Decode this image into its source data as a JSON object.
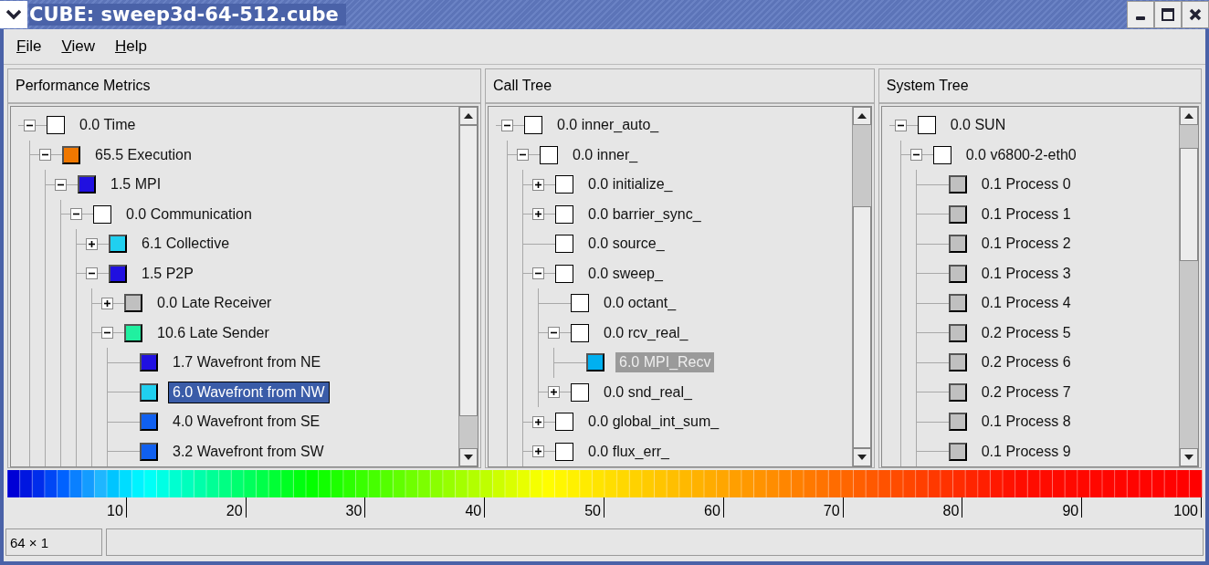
{
  "window": {
    "title": "CUBE: sweep3d-64-512.cube"
  },
  "menu": [
    "File",
    "View",
    "Help"
  ],
  "panels": [
    {
      "title": "Performance Metrics",
      "tree": [
        {
          "label": "0.0 Time",
          "color": "#ffffff",
          "expanded": true,
          "selected": false,
          "children": [
            {
              "label": "65.5 Execution",
              "color": "#f07800",
              "expanded": true,
              "selected": false,
              "children": [
                {
                  "label": "1.5 MPI",
                  "color": "#2010e0",
                  "expanded": true,
                  "selected": false,
                  "children": [
                    {
                      "label": "0.0 Communication",
                      "color": "#ffffff",
                      "expanded": true,
                      "selected": false,
                      "children": [
                        {
                          "label": "6.1 Collective",
                          "color": "#20d0f0",
                          "expanded": false,
                          "selected": false
                        },
                        {
                          "label": "1.5 P2P",
                          "color": "#2010e0",
                          "expanded": true,
                          "selected": false,
                          "children": [
                            {
                              "label": "0.0 Late Receiver",
                              "color": "#c0c0c0",
                              "expanded": false,
                              "selected": false
                            },
                            {
                              "label": "10.6 Late Sender",
                              "color": "#20f0a0",
                              "expanded": true,
                              "selected": false,
                              "children": [
                                {
                                  "label": "1.7 Wavefront from NE",
                                  "color": "#2010e0",
                                  "selected": false
                                },
                                {
                                  "label": "6.0 Wavefront from NW",
                                  "color": "#20d0f0",
                                  "selected": true,
                                  "focused": true
                                },
                                {
                                  "label": "4.0 Wavefront from SE",
                                  "color": "#1060f0",
                                  "selected": false
                                },
                                {
                                  "label": "3.2 Wavefront from SW",
                                  "color": "#1060f0",
                                  "selected": false
                                }
                              ]
                            }
                          ]
                        }
                      ]
                    }
                  ]
                }
              ]
            }
          ]
        }
      ]
    },
    {
      "title": "Call Tree",
      "tree": [
        {
          "label": "0.0 inner_auto_",
          "color": "#ffffff",
          "expanded": true,
          "selected": false,
          "children": [
            {
              "label": "0.0 inner_",
              "color": "#ffffff",
              "expanded": true,
              "selected": false,
              "children": [
                {
                  "label": "0.0 initialize_",
                  "color": "#ffffff",
                  "expanded": false,
                  "selected": false
                },
                {
                  "label": "0.0 barrier_sync_",
                  "color": "#ffffff",
                  "expanded": false,
                  "selected": false
                },
                {
                  "label": "0.0 source_",
                  "color": "#ffffff",
                  "selected": false
                },
                {
                  "label": "0.0 sweep_",
                  "color": "#ffffff",
                  "expanded": true,
                  "selected": false,
                  "children": [
                    {
                      "label": "0.0 octant_",
                      "color": "#ffffff",
                      "selected": false
                    },
                    {
                      "label": "0.0 rcv_real_",
                      "color": "#ffffff",
                      "expanded": true,
                      "selected": false,
                      "children": [
                        {
                          "label": "6.0 MPI_Recv",
                          "color": "#00b0f0",
                          "selected": true,
                          "focused": false
                        }
                      ]
                    },
                    {
                      "label": "0.0 snd_real_",
                      "color": "#ffffff",
                      "expanded": false,
                      "selected": false
                    }
                  ]
                },
                {
                  "label": "0.0 global_int_sum_",
                  "color": "#ffffff",
                  "expanded": false,
                  "selected": false
                },
                {
                  "label": "0.0 flux_err_",
                  "color": "#ffffff",
                  "expanded": false,
                  "selected": false
                }
              ]
            }
          ]
        }
      ]
    },
    {
      "title": "System Tree",
      "tree": [
        {
          "label": "0.0 SUN",
          "color": "#ffffff",
          "expanded": true,
          "selected": false,
          "children": [
            {
              "label": "0.0 v6800-2-eth0",
              "color": "#ffffff",
              "expanded": true,
              "selected": false,
              "children": [
                {
                  "label": "0.1 Process 0",
                  "color": "#c0c0c0",
                  "selected": false
                },
                {
                  "label": "0.1 Process 1",
                  "color": "#c0c0c0",
                  "selected": false
                },
                {
                  "label": "0.1 Process 2",
                  "color": "#c0c0c0",
                  "selected": false
                },
                {
                  "label": "0.1 Process 3",
                  "color": "#c0c0c0",
                  "selected": false
                },
                {
                  "label": "0.1 Process 4",
                  "color": "#c0c0c0",
                  "selected": false
                },
                {
                  "label": "0.2 Process 5",
                  "color": "#c0c0c0",
                  "selected": false
                },
                {
                  "label": "0.2 Process 6",
                  "color": "#c0c0c0",
                  "selected": false
                },
                {
                  "label": "0.2 Process 7",
                  "color": "#c0c0c0",
                  "selected": false
                },
                {
                  "label": "0.1 Process 8",
                  "color": "#c0c0c0",
                  "selected": false
                },
                {
                  "label": "0.1 Process 9",
                  "color": "#c0c0c0",
                  "selected": false
                }
              ]
            }
          ]
        }
      ]
    }
  ],
  "color_scale": {
    "ticks": [
      "10",
      "20",
      "30",
      "40",
      "50",
      "60",
      "70",
      "80",
      "90",
      "100"
    ]
  },
  "status_bar": {
    "dimensions": "64 × 1"
  }
}
